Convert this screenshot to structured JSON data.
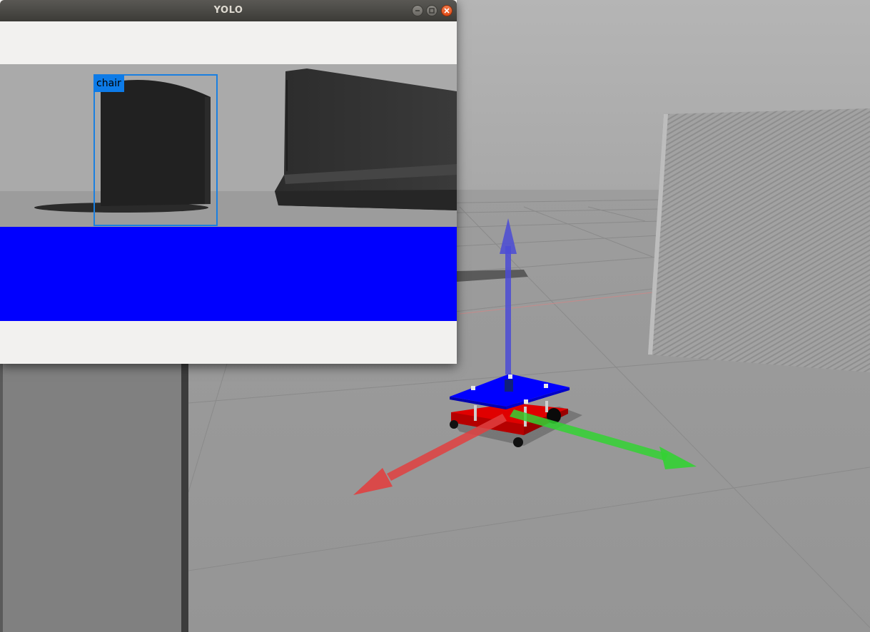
{
  "window": {
    "title": "YOLO",
    "buttons": {
      "minimize": "minimize-icon",
      "maximize": "maximize-icon",
      "close": "close-icon"
    }
  },
  "detections": [
    {
      "label": "chair",
      "color": "#0d7be8"
    }
  ],
  "colors": {
    "detection_box": "#1a7fe0",
    "detection_label_bg": "#0d7be8",
    "frame_bottom_band": "#0000ff",
    "robot_top_plate": "#0000ff",
    "robot_base_plate": "#ff0000",
    "axis_x": "#e03030",
    "axis_y": "#30d030",
    "axis_z": "#3a3ad8",
    "titlebar": "#3c3b37",
    "close_button": "#df4a16"
  },
  "gazebo": {
    "toolbar_icons": [
      "cursor-icon",
      "translate-icon",
      "rotate-icon",
      "scale-icon",
      "undo-icon",
      "copy-icon",
      "align-icon",
      "snap-icon",
      "light-icon",
      "screenshot-icon",
      "log-icon"
    ]
  }
}
